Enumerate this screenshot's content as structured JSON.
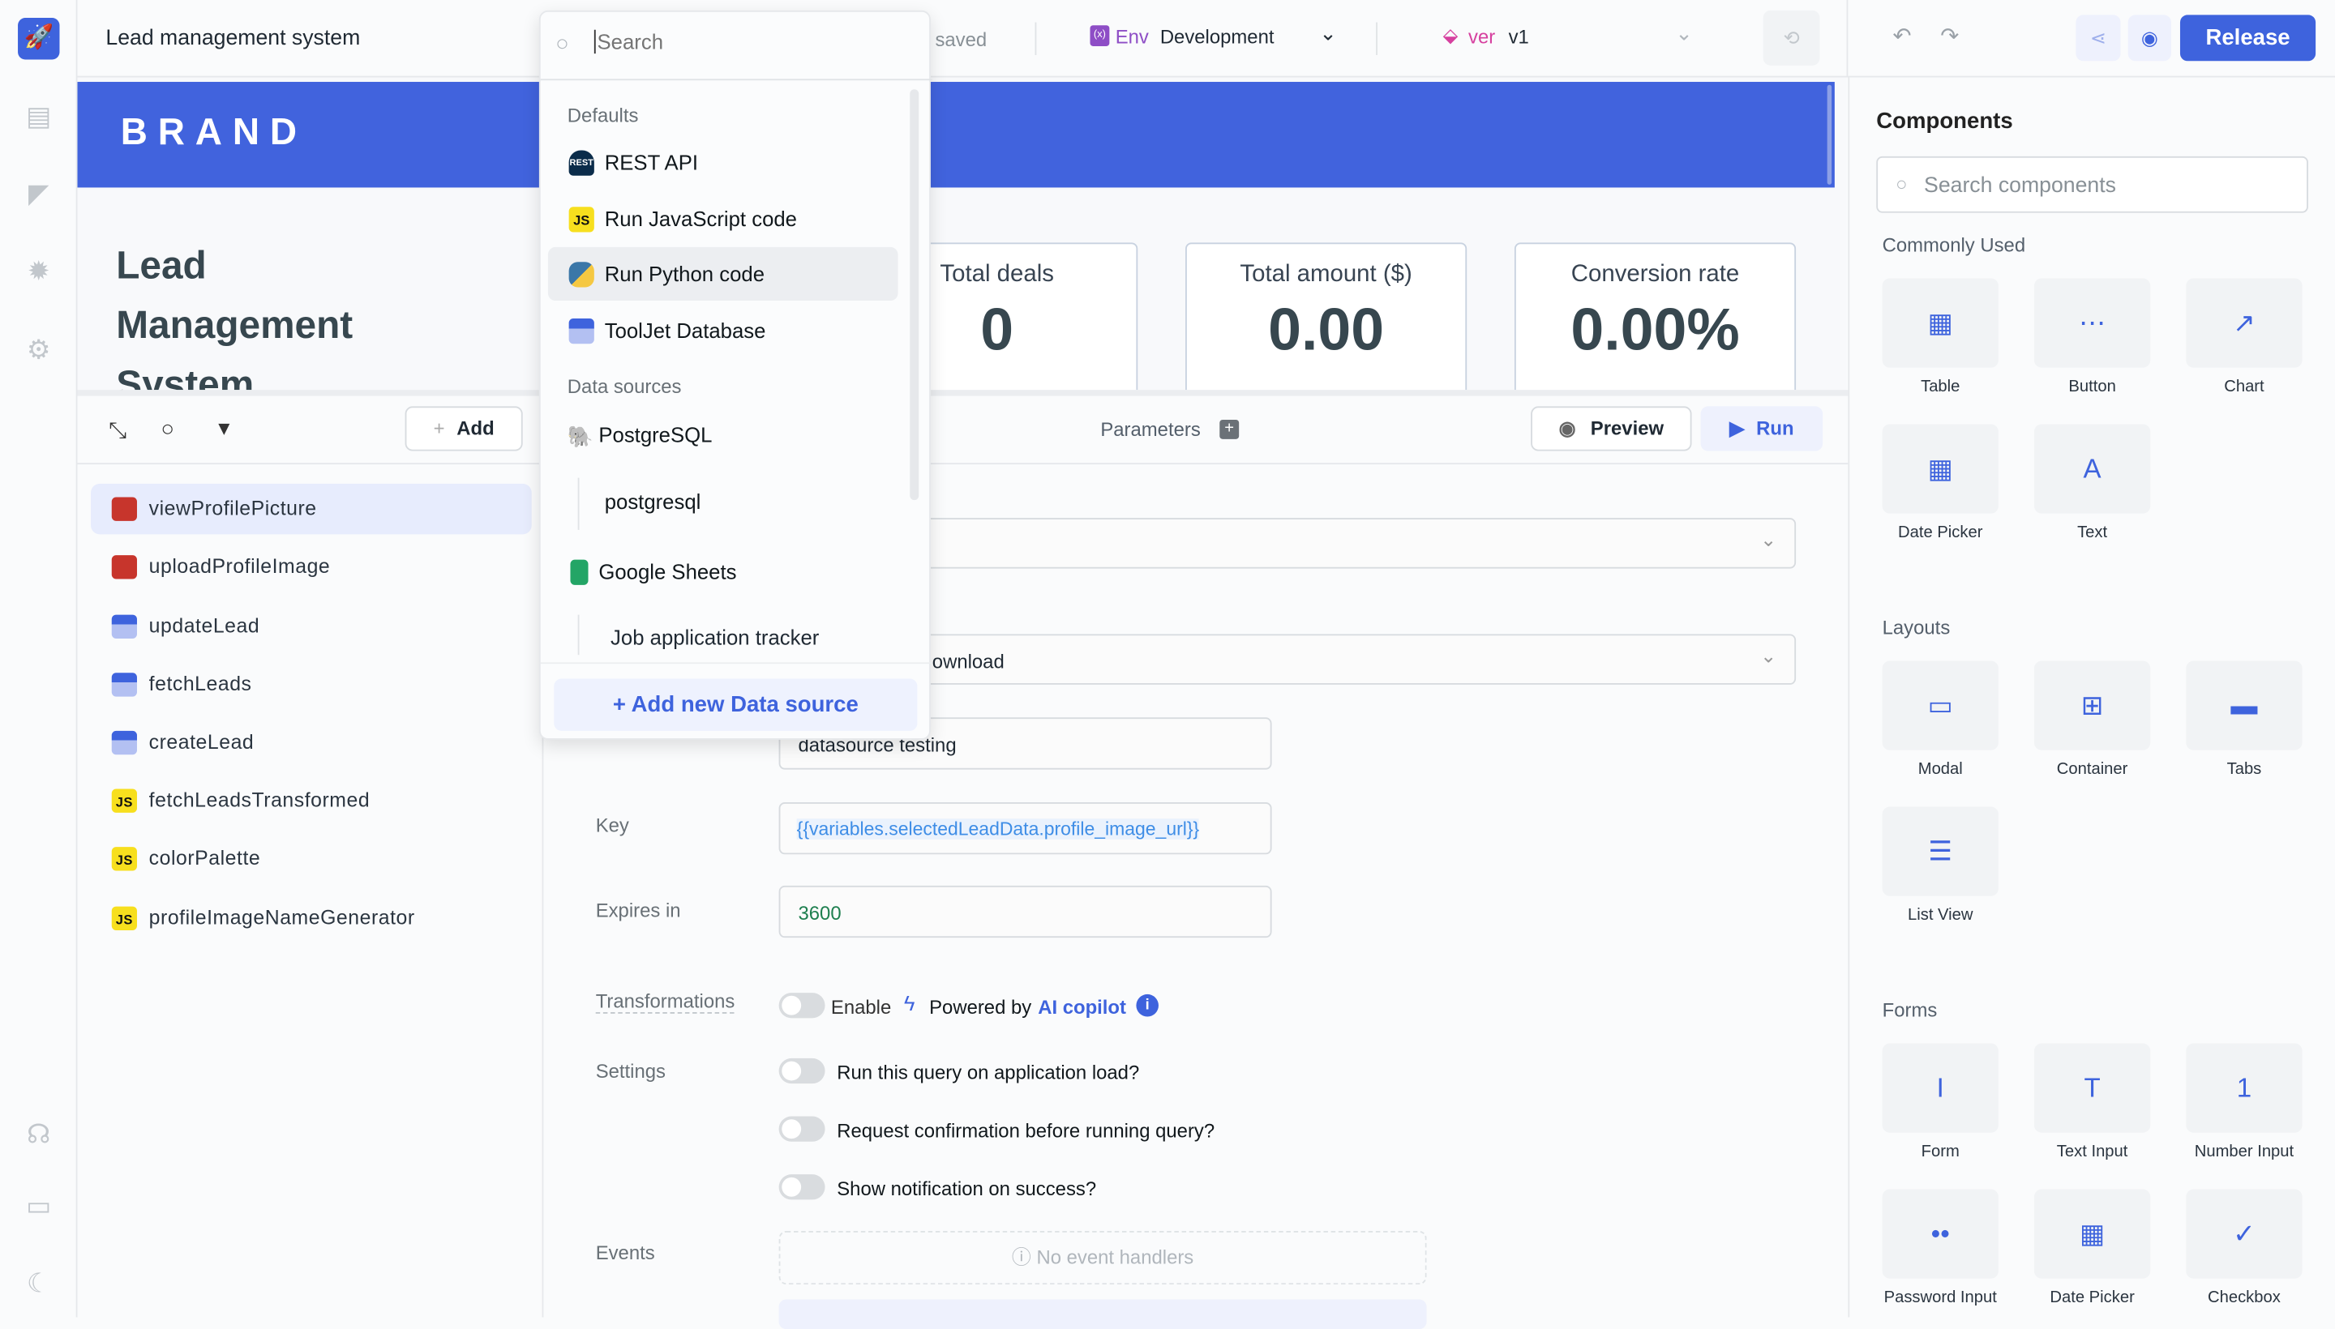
{
  "app": {
    "title": "Lead management system",
    "save_status": "saved",
    "env_label": "Env",
    "env_value": "Development",
    "ver_label": "ver",
    "ver_value": "v1",
    "release": "Release"
  },
  "colors": {
    "accent": "#3e63dd",
    "brand_header": "#4163dd",
    "js": "#f7df1e",
    "s3": "#c7352c"
  },
  "canvas": {
    "brand": "BRAND",
    "heading": [
      "Lead",
      "Management",
      "System"
    ],
    "cards": [
      {
        "label": "Total deals",
        "value": "0"
      },
      {
        "label": "Total amount ($)",
        "value": "0.00"
      },
      {
        "label": "Conversion rate",
        "value": "0.00%"
      }
    ]
  },
  "queries": {
    "add": "Add",
    "items": [
      {
        "name": "viewProfilePicture",
        "icon": "s3-icon"
      },
      {
        "name": "uploadProfileImage",
        "icon": "s3-icon"
      },
      {
        "name": "updateLead",
        "icon": "tooljet-db-icon"
      },
      {
        "name": "fetchLeads",
        "icon": "tooljet-db-icon"
      },
      {
        "name": "createLead",
        "icon": "tooljet-db-icon"
      },
      {
        "name": "fetchLeadsTransformed",
        "icon": "js-icon"
      },
      {
        "name": "colorPalette",
        "icon": "js-icon"
      },
      {
        "name": "profileImageNameGenerator",
        "icon": "js-icon"
      }
    ]
  },
  "editor": {
    "parameters": "Parameters",
    "preview": "Preview",
    "run": "Run",
    "operation": "ownload",
    "bucket": "datasource testing",
    "key_label": "Key",
    "key_value": "{{variables.selectedLeadData.profile_image_url}}",
    "expires_label": "Expires in",
    "expires_value": "3600",
    "transformations": "Transformations",
    "enable": "Enable",
    "powered_by": "Powered by",
    "ai_copilot": "AI copilot",
    "settings": "Settings",
    "settings_items": [
      "Run this query on application load?",
      "Request confirmation before running query?",
      "Show notification on success?"
    ],
    "events": "Events",
    "no_events": "No event handlers"
  },
  "dropdown": {
    "placeholder": "Search",
    "defaults_header": "Defaults",
    "defaults": [
      "REST API",
      "Run JavaScript code",
      "Run Python code",
      "ToolJet Database"
    ],
    "sources_header": "Data sources",
    "sources": [
      {
        "kind": "PostgreSQL",
        "instances": [
          "postgresql"
        ]
      },
      {
        "kind": "Google Sheets",
        "instances": [
          "Job application tracker"
        ]
      }
    ],
    "add_new": "+ Add new Data source"
  },
  "components": {
    "title": "Components",
    "search_placeholder": "Search components",
    "sections": [
      {
        "name": "Commonly Used",
        "items": [
          "Table",
          "Button",
          "Chart",
          "Date Picker",
          "Text"
        ]
      },
      {
        "name": "Layouts",
        "items": [
          "Modal",
          "Container",
          "Tabs",
          "List View"
        ]
      },
      {
        "name": "Forms",
        "items": [
          "Form",
          "Text Input",
          "Number Input",
          "Password Input",
          "Date Picker",
          "Checkbox"
        ]
      }
    ]
  }
}
